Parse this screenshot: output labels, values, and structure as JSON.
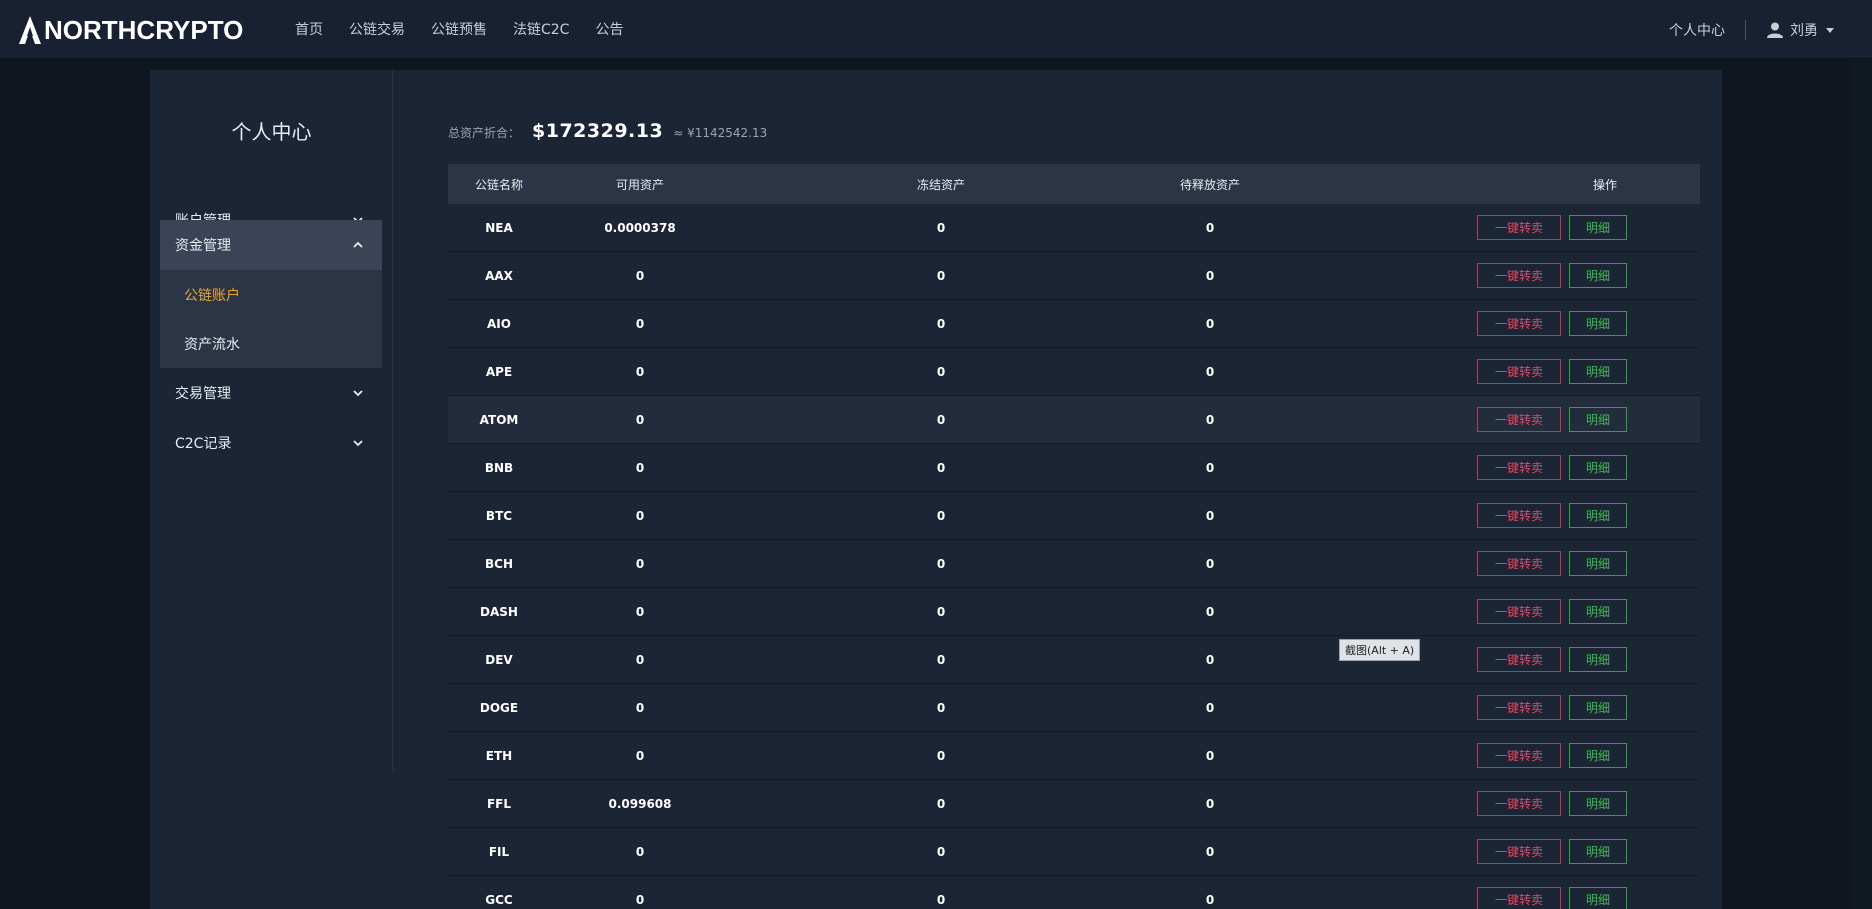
{
  "brand": {
    "name": "NORTHCRYPTO"
  },
  "nav": {
    "items": [
      "首页",
      "公链交易",
      "公链预售",
      "法链C2C",
      "公告"
    ]
  },
  "top_right": {
    "center_label": "个人中心",
    "user_name": "刘勇"
  },
  "sidebar": {
    "title": "个人中心",
    "menu": [
      {
        "label": "账户管理"
      },
      {
        "label": "资金管理"
      },
      {
        "label": "交易管理"
      },
      {
        "label": "C2C记录"
      }
    ],
    "sub": {
      "current": "公链账户",
      "other": "资产流水"
    }
  },
  "summary": {
    "label": "总资产折合：",
    "usd": "$172329.13",
    "cny": "≈ ¥1142542.13"
  },
  "table": {
    "headers": [
      "公链名称",
      "可用资产",
      "冻结资产",
      "待释放资产",
      "操作"
    ],
    "sell_label": "一键转卖",
    "detail_label": "明细",
    "rows": [
      {
        "name": "NEA",
        "available": "0.0000378",
        "frozen": "0",
        "pending": "0"
      },
      {
        "name": "AAX",
        "available": "0",
        "frozen": "0",
        "pending": "0"
      },
      {
        "name": "AIO",
        "available": "0",
        "frozen": "0",
        "pending": "0"
      },
      {
        "name": "APE",
        "available": "0",
        "frozen": "0",
        "pending": "0"
      },
      {
        "name": "ATOM",
        "available": "0",
        "frozen": "0",
        "pending": "0"
      },
      {
        "name": "BNB",
        "available": "0",
        "frozen": "0",
        "pending": "0"
      },
      {
        "name": "BTC",
        "available": "0",
        "frozen": "0",
        "pending": "0"
      },
      {
        "name": "BCH",
        "available": "0",
        "frozen": "0",
        "pending": "0"
      },
      {
        "name": "DASH",
        "available": "0",
        "frozen": "0",
        "pending": "0"
      },
      {
        "name": "DEV",
        "available": "0",
        "frozen": "0",
        "pending": "0"
      },
      {
        "name": "DOGE",
        "available": "0",
        "frozen": "0",
        "pending": "0"
      },
      {
        "name": "ETH",
        "available": "0",
        "frozen": "0",
        "pending": "0"
      },
      {
        "name": "FFL",
        "available": "0.099608",
        "frozen": "0",
        "pending": "0"
      },
      {
        "name": "FIL",
        "available": "0",
        "frozen": "0",
        "pending": "0"
      },
      {
        "name": "GCC",
        "available": "0",
        "frozen": "0",
        "pending": "0"
      }
    ]
  },
  "tooltip": {
    "text": "截图(Alt + A)"
  }
}
